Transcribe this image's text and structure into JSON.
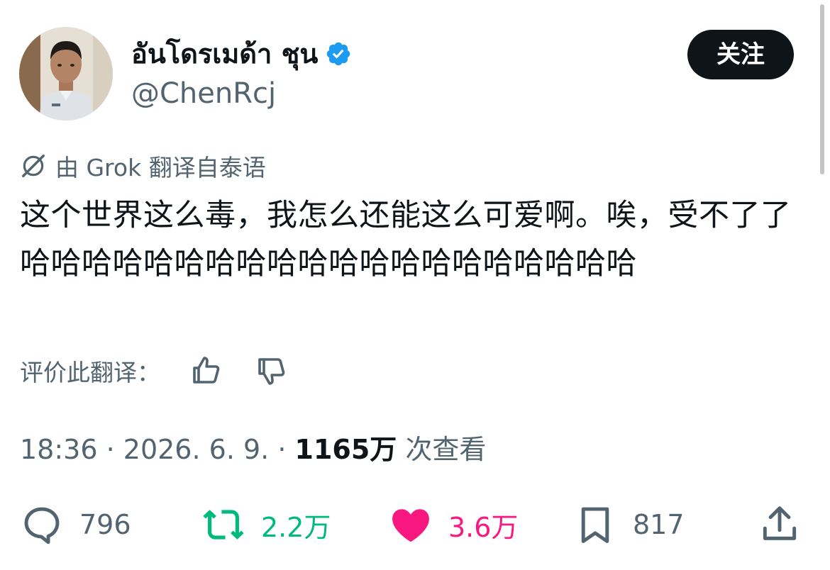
{
  "author": {
    "display_name": "อันโดรเมด้า ชุน",
    "handle": "@ChenRcj",
    "verified": true
  },
  "follow_button": {
    "label": "关注"
  },
  "translation": {
    "notice": "由 Grok 翻译自泰语"
  },
  "tweet": {
    "text": "这个世界这么毒，我怎么还能这么可爱啊。唉，受不了了哈哈哈哈哈哈哈哈哈哈哈哈哈哈哈哈哈哈哈哈"
  },
  "rate_translation": {
    "label": "评价此翻译："
  },
  "meta": {
    "time": "18:36",
    "date": "2026. 6. 9.",
    "views_count": "1165万",
    "views_label": "次查看"
  },
  "actions": {
    "replies": "796",
    "retweets": "2.2万",
    "likes": "3.6万",
    "bookmarks": "817"
  },
  "colors": {
    "text": "#0f1419",
    "secondary": "#536471",
    "verified": "#1d9bf0",
    "retweet": "#00ba7c",
    "like": "#f91880"
  }
}
